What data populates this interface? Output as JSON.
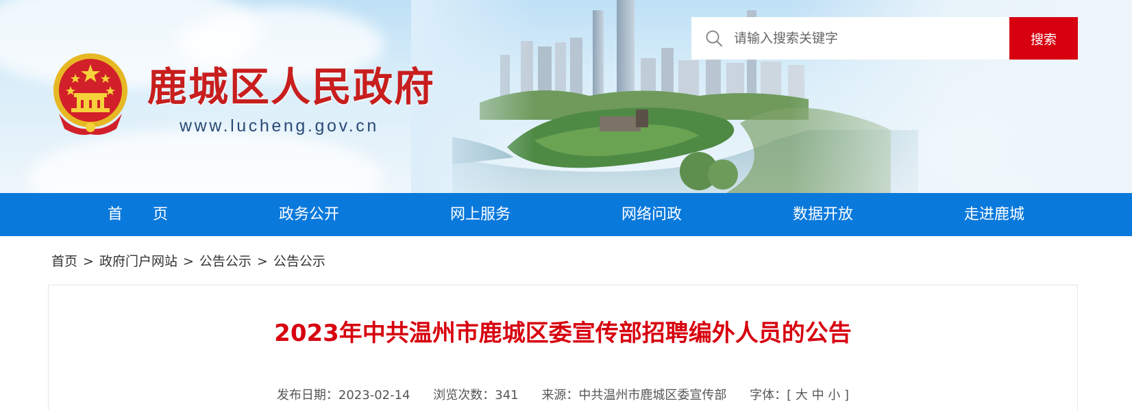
{
  "header": {
    "site_title": "鹿城区人民政府",
    "site_url": "www.lucheng.gov.cn",
    "search": {
      "placeholder": "请输入搜索关键字",
      "button_label": "搜索"
    },
    "colors": {
      "title_red": "#c81e1e",
      "search_button": "#d7000f",
      "url_blue": "#2a4a77"
    }
  },
  "nav": {
    "items": [
      "首　　页",
      "政务公开",
      "网上服务",
      "网络问政",
      "数据开放",
      "走进鹿城"
    ],
    "background": "#0a79dc"
  },
  "breadcrumb": {
    "items": [
      "首页",
      "政府门户网站",
      "公告公示",
      "公告公示"
    ],
    "separator": ">"
  },
  "article": {
    "title": "2023年中共温州市鹿城区委宣传部招聘编外人员的公告",
    "meta": {
      "date_label": "发布日期：",
      "date": "2023-02-14",
      "views_label": "浏览次数：",
      "views": "341",
      "source_label": "来源：",
      "source": "中共温州市鹿城区委宣传部",
      "font_label": "字体：",
      "font_open": "[",
      "font_large": "大",
      "font_medium": "中",
      "font_small": "小",
      "font_close": "]"
    }
  }
}
